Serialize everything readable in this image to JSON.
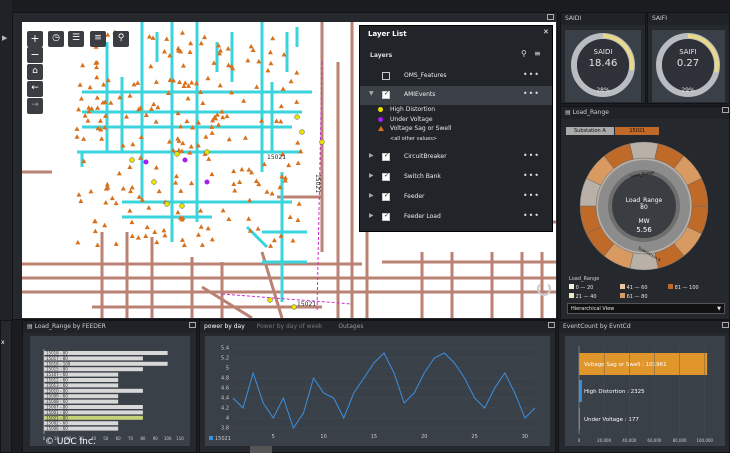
{
  "layer_list": {
    "title": "Layer List",
    "section": "Layers",
    "layers": [
      {
        "label": "OMS_Features",
        "checked": false
      },
      {
        "label": "AMIEvents",
        "checked": true
      }
    ],
    "legend": [
      {
        "label": "High Distortion",
        "color": "#e8e000",
        "shape": "circle"
      },
      {
        "label": "Under Voltage",
        "color": "#a020f0",
        "shape": "circle"
      },
      {
        "label": "Voltage Sag or Swell",
        "color": "#e0701a",
        "shape": "triangle"
      },
      {
        "label": "<all other values>",
        "color": "",
        "shape": "none"
      }
    ],
    "more_layers": [
      {
        "label": "CircuitBreaker",
        "checked": true
      },
      {
        "label": "Switch Bank",
        "checked": true
      },
      {
        "label": "Feeder",
        "checked": true
      },
      {
        "label": "Feeder Load",
        "checked": true
      }
    ]
  },
  "map": {
    "labels": [
      "15021",
      "15021",
      "15021"
    ]
  },
  "saidi": {
    "tab": "SAIDI",
    "label": "SAIDI",
    "value": "18.46",
    "pct": "28%",
    "fraction": 0.28
  },
  "saifi": {
    "tab": "SAIFI",
    "label": "SAIFI",
    "value": "0.27",
    "pct": "29%",
    "fraction": 0.29
  },
  "load_range_panel": {
    "tab": "Load_Range",
    "crumbs": [
      "Substation A",
      "15021"
    ],
    "center_label": "Load_Range",
    "center_value": "80",
    "center_unit": "MW",
    "center_mw": "5.56",
    "ring_labels": [
      "Load_Range",
      "Substation A"
    ],
    "legend_title": "Load_Range",
    "legend": [
      {
        "label": "0 — 20",
        "color": "#f4efd9"
      },
      {
        "label": "41 — 60",
        "color": "#e8c7a0"
      },
      {
        "label": "81 — 100",
        "color": "#c06a2a"
      },
      {
        "label": "21 — 40",
        "color": "#f1e6c2"
      },
      {
        "label": "61 — 80",
        "color": "#d99a62"
      }
    ],
    "view_select": "Hierarchical View"
  },
  "feeder_panel": {
    "tab": "Load_Range by FEEDER",
    "rows": [
      "15018 - 80",
      "15017 - 80",
      "15016 - 100",
      "15015 - 80",
      "15107 - 60",
      "15012 - 60",
      "15013 - 60",
      "15010 - 80",
      "15009 - 60",
      "15008 - 60",
      "15007 - 80",
      "15001 - 80",
      "15021 - 80",
      "15002 - 60",
      "15006 - 60"
    ],
    "values": [
      100,
      80,
      100,
      80,
      60,
      60,
      60,
      80,
      60,
      60,
      80,
      80,
      80,
      60,
      60
    ],
    "x_ticks": [
      "0",
      "10",
      "20",
      "30",
      "40",
      "50",
      "60",
      "70",
      "80",
      "90",
      "100",
      "110"
    ],
    "copyright": "© UDC Inc."
  },
  "power_panel": {
    "tabs": [
      "power by day",
      "Power by day of week",
      "Outages"
    ],
    "y_ticks": [
      "5.4",
      "5.2",
      "5",
      "4.8",
      "4.6",
      "4.4",
      "4.2",
      "4",
      "3.8"
    ],
    "x_ticks": [
      "5",
      "10",
      "15",
      "20",
      "25",
      "30"
    ],
    "legend": "15021"
  },
  "event_panel": {
    "tab": "EventCount by EvntCd",
    "bars": [
      {
        "label": "Voltage Sag or Swell : 101961",
        "value": 101961
      },
      {
        "label": "High Distortion : 2325",
        "value": 2325
      },
      {
        "label": "Under Voltage : 177",
        "value": 177
      }
    ],
    "x_ticks": [
      "0",
      "20,000",
      "40,000",
      "60,000",
      "80,000",
      "100,000"
    ]
  },
  "chart_data": [
    {
      "type": "bar",
      "title": "Load_Range by FEEDER",
      "categories": [
        "15018",
        "15017",
        "15016",
        "15015",
        "15107",
        "15012",
        "15013",
        "15010",
        "15009",
        "15008",
        "15007",
        "15001",
        "15021",
        "15002",
        "15006"
      ],
      "values": [
        100,
        80,
        100,
        80,
        60,
        60,
        60,
        80,
        60,
        60,
        80,
        80,
        80,
        60,
        60
      ],
      "xlim": [
        0,
        110
      ]
    },
    {
      "type": "line",
      "title": "power by day",
      "series": [
        {
          "name": "15021",
          "x": [
            1,
            2,
            3,
            4,
            5,
            6,
            7,
            8,
            9,
            10,
            11,
            12,
            13,
            14,
            15,
            16,
            17,
            18,
            19,
            20,
            21,
            22,
            23,
            24,
            25,
            26,
            27,
            28,
            29,
            30,
            31
          ],
          "values": [
            4.4,
            4.2,
            4.9,
            4.3,
            4.0,
            4.4,
            3.8,
            4.1,
            4.8,
            4.5,
            4.4,
            4.0,
            4.5,
            4.8,
            5.1,
            5.3,
            4.9,
            4.3,
            4.5,
            4.9,
            5.2,
            5.3,
            5.1,
            4.8,
            4.4,
            4.2,
            4.6,
            4.9,
            4.5,
            4.0,
            4.2
          ]
        }
      ],
      "ylim": [
        3.8,
        5.4
      ]
    },
    {
      "type": "bar",
      "title": "EventCount by EvntCd",
      "categories": [
        "Voltage Sag or Swell",
        "High Distortion",
        "Under Voltage"
      ],
      "values": [
        101961,
        2325,
        177
      ],
      "xlim": [
        0,
        100000
      ]
    }
  ]
}
